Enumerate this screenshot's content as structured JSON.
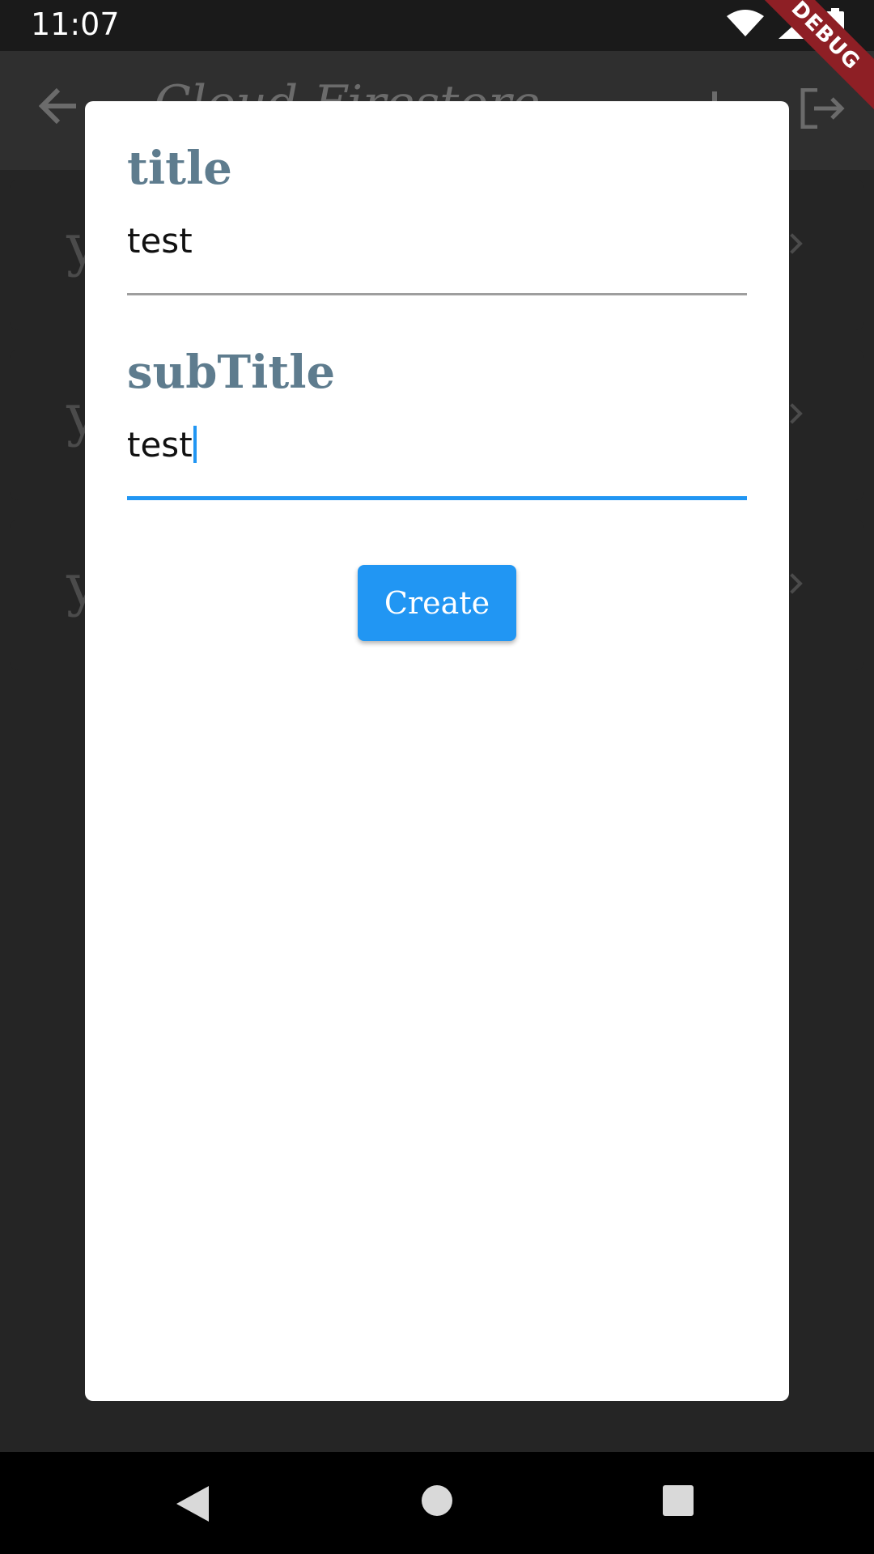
{
  "status_bar": {
    "time": "11:07",
    "icons": [
      "wifi-icon",
      "signal-icon",
      "battery-icon"
    ]
  },
  "debug_banner": "DEBUG",
  "app_bar": {
    "title": "Cloud Firestore",
    "icons": [
      "back-arrow-icon",
      "add-icon",
      "logout-icon"
    ]
  },
  "background_list": {
    "items": [
      {
        "leading": "y"
      },
      {
        "leading": "y"
      },
      {
        "leading": "y"
      }
    ]
  },
  "dialog": {
    "title_field": {
      "label": "title",
      "value": "test"
    },
    "subtitle_field": {
      "label": "subTitle",
      "value": "test"
    },
    "create_button": "Create"
  },
  "colors": {
    "accent": "#2196f3",
    "label": "#5e7c8e",
    "debug": "#8e1f25"
  },
  "nav_bar": {
    "icons": [
      "back-triangle-icon",
      "home-circle-icon",
      "recents-square-icon"
    ]
  }
}
